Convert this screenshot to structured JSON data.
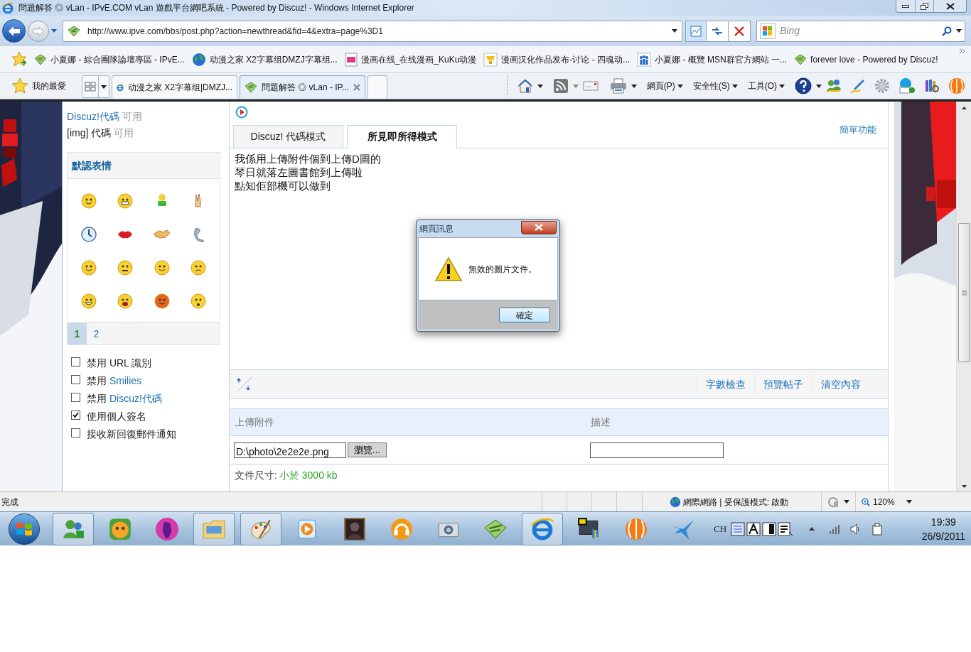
{
  "window": {
    "title": "問題解答 ◎ vLan - IPvE.COM vLan 遊戲平台網吧系統 - Powered by Discuz! - Windows Internet Explorer"
  },
  "nav": {
    "address": "http://www.ipve.com/bbs/post.php?action=newthread&fid=4&extra=page%3D1",
    "search_placeholder": "Bing"
  },
  "favorites": [
    {
      "label": "小夏娜 - 綜合團隊論壇專區 - IPvE...",
      "kind": "site"
    },
    {
      "label": "动漫之家 X2字幕组DMZJ字幕组...",
      "kind": "globe"
    },
    {
      "label": "漫画在线_在线漫画_KuKu动漫",
      "kind": "ku"
    },
    {
      "label": "漫画汉化作品发布-讨论 - 四魂动...",
      "kind": "cup"
    },
    {
      "label": "小夏娜 - 概覽  MSN群官方網站 一...",
      "kind": "people"
    },
    {
      "label": "forever love - Powered by Discuz!",
      "kind": "site"
    }
  ],
  "favorites_button": "我的最愛",
  "tabs": [
    {
      "label": "动漫之家 X2字幕组|DMZJ...",
      "selected": false
    },
    {
      "label": "問題解答 ◎ vLan - IP...",
      "selected": true
    }
  ],
  "command_bar": [
    "網頁(P)",
    "安全性(S)",
    "工具(O)"
  ],
  "sidebar": {
    "code_status": [
      {
        "label": "Discuz!代碼",
        "value": "可用",
        "kind": "link"
      },
      {
        "label": "[img] 代碼",
        "value": "可用",
        "kind": "plain"
      }
    ],
    "smilies": {
      "title": "默認表情",
      "pages": [
        {
          "label": "1",
          "selected": true
        },
        {
          "label": "2",
          "selected": false
        }
      ]
    },
    "options": [
      {
        "label": "禁用 URL 識別",
        "checked": false
      },
      {
        "label": "禁用",
        "link": "Smilies",
        "checked": false
      },
      {
        "label": "禁用",
        "link": "Discuz!代碼",
        "checked": false
      },
      {
        "label": "使用個人簽名",
        "checked": true
      },
      {
        "label": "接收新回復郵件通知",
        "checked": false
      }
    ]
  },
  "editor": {
    "tabs": [
      {
        "label": "Discuz! 代碼模式",
        "selected": false
      },
      {
        "label": "所見即所得模式",
        "selected": true
      }
    ],
    "simple_link": "簡單功能",
    "lines": [
      "我係用上傳附件個到上傳D圖的",
      "琴日就落左圖書館到上傳啦",
      "點知佢部機可以做到"
    ],
    "actions": [
      "字數檢查",
      "預覽帖子",
      "清空內容"
    ]
  },
  "attachments": {
    "columns": [
      "上傳附件",
      "描述"
    ],
    "file_value": "D:\\photo\\2e2e2e.png",
    "browse": "瀏覽...",
    "size_label": "文件尺寸:",
    "size_value": "小於 3000 kb"
  },
  "dialog": {
    "title": "網頁訊息",
    "message": "無效的圖片文件。",
    "ok": "確定"
  },
  "status_bar": {
    "text": "完成",
    "zone": "網際網路 | 受保護模式: 啟動",
    "zoom": "120%"
  },
  "taskbar": {
    "apps": [
      {
        "running": true
      },
      {
        "running": false
      },
      {
        "running": false
      },
      {
        "running": true
      },
      {
        "running": true
      },
      {
        "running": false
      },
      {
        "running": false
      },
      {
        "running": false
      },
      {
        "running": false
      },
      {
        "running": false
      },
      {
        "running": true
      },
      {
        "running": false
      },
      {
        "running": false
      },
      {
        "running": false
      }
    ],
    "language": "CH",
    "time": "19:39",
    "date": "26/9/2011"
  }
}
